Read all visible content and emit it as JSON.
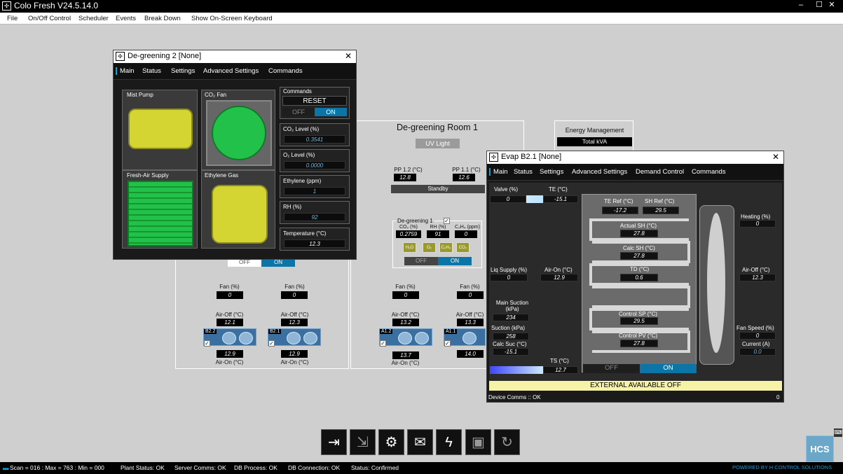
{
  "window": {
    "title": "Colo Fresh V24.5.14.0",
    "app_icon": "app-logo-icon"
  },
  "menu": [
    "File",
    "On/Off Control",
    "Scheduler",
    "Events",
    "Break Down",
    "Show On-Screen Keyboard"
  ],
  "room": {
    "title": "De-greening Room 1",
    "uv_light_label": "UV Light",
    "pp12_label": "PP 1.2 (°C)",
    "pp12_value": "12.8",
    "pp11_label": "PP 1.1 (°C)",
    "pp11_value": "12.6",
    "standby_label": "Standby",
    "deg1_label": "De-greening 1",
    "deg1_co2_label": "CO₂ (%)",
    "deg1_co2_value": "0.2759",
    "deg1_rh_label": "RH (%)",
    "deg1_rh_value": "91",
    "deg1_c2h4_label": "C₂H₄ (ppm)",
    "deg1_c2h4_value": "0",
    "deg1_icons": [
      "H₂O",
      "O₂",
      "C₂H₄",
      "CO₂"
    ],
    "off_label": "OFF",
    "on_label": "ON"
  },
  "energy": {
    "title": "Energy Management",
    "total_kva_label": "Total kVA"
  },
  "left_room": {
    "off_label": "OFF",
    "on_label": "ON",
    "units": [
      {
        "fan_label": "Fan (%)",
        "fan_value": "0",
        "airoff_label": "Air-Off (°C)",
        "airoff_value": "12.1",
        "tag": "B2.2",
        "airon_value": "12.9",
        "airon_label": "Air-On (°C)"
      },
      {
        "fan_label": "Fan (%)",
        "fan_value": "0",
        "airoff_label": "Air-Off (°C)",
        "airoff_value": "12.3",
        "tag": "B2.1",
        "airon_value": "12.9",
        "airon_label": "Air-On (°C)"
      }
    ]
  },
  "right_room": {
    "units": [
      {
        "fan_label": "Fan (%)",
        "fan_value": "0",
        "airoff_label": "Air-Off (°C)",
        "airoff_value": "13.2",
        "tag": "A1.2",
        "airon_value": "13.7",
        "airon_label": "Air-On (°C)"
      },
      {
        "fan_label": "Fan (%)",
        "fan_value": "0",
        "airoff_label": "Air-Off (°C)",
        "airoff_value": "13.3",
        "tag": "A1.1",
        "airon_value": "14.0",
        "airon_label": "Air-On (°C)"
      }
    ]
  },
  "dialog1": {
    "title": "De-greening 2 [None]",
    "tabs": [
      "Main",
      "Status",
      "Settings",
      "Advanced Settings",
      "Commands"
    ],
    "mist_pump": "Mist Pump",
    "co2_fan": "CO₂ Fan",
    "fresh_air": "Fresh-Air Supply",
    "ethylene_gas": "Ethylene Gas",
    "commands_label": "Commands",
    "reset_label": "RESET",
    "off_label": "OFF",
    "on_label": "ON",
    "co2_label": "CO₂ Level (%)",
    "co2_value": "0.3541",
    "o2_label": "O₂ Level (%)",
    "o2_value": "0.0000",
    "ethylene_label": "Ethylene (ppm)",
    "ethylene_value": "1",
    "rh_label": "RH (%)",
    "rh_value": "92",
    "temp_label": "Temperature (°C)",
    "temp_value": "12.3"
  },
  "dialog2": {
    "title": "Evap B2.1 [None]",
    "tabs": [
      "Main",
      "Status",
      "Settings",
      "Advanced Settings",
      "Demand Control",
      "Commands"
    ],
    "valve_label": "Valve (%)",
    "valve_value": "0",
    "te_label": "TE (°C)",
    "te_value": "-15.1",
    "te_ref_label": "TE Ref (°C)",
    "te_ref_value": "-17.2",
    "sh_ref_label": "SH Ref (°C)",
    "sh_ref_value": "29.5",
    "actual_sh_label": "Actual SH (°C)",
    "actual_sh_value": "27.8",
    "calc_sh_label": "Calc SH (°C)",
    "calc_sh_value": "27.8",
    "td_label": "TD (°C)",
    "td_value": "0.6",
    "control_sp_label": "Control SP (°C)",
    "control_sp_value": "29.5",
    "control_pv_label": "Control PV (°C)",
    "control_pv_value": "27.8",
    "liq_supply_label": "Liq Supply (%)",
    "liq_supply_value": "0",
    "air_on_label": "Air-On (°C)",
    "air_on_value": "12.9",
    "main_suction_label": "Main Suction (kPa)",
    "main_suction_value": "234",
    "suction_label": "Suction (kPa)",
    "suction_value": "258",
    "calc_suc_label": "Calc Suc (°C)",
    "calc_suc_value": "-15.1",
    "ts_label": "TS (°C)",
    "ts_value": "12.7",
    "heating_label": "Heating (%)",
    "heating_value": "0",
    "air_off_label": "Air-Off (°C)",
    "air_off_value": "12.3",
    "fan_speed_label": "Fan Speed (%)",
    "fan_speed_value": "0",
    "current_label": "Current (A)",
    "current_value": "0.0",
    "off_label": "OFF",
    "on_label": "ON",
    "external_label": "EXTERNAL AVAILABLE OFF",
    "comms_label": "Device Comms :: OK",
    "comms_count": "0"
  },
  "toolbar": [
    "login-icon",
    "logout-icon",
    "user-settings-icon",
    "mail-icon",
    "power-icon",
    "save-icon",
    "refresh-icon"
  ],
  "logo_text": "HCS",
  "status": {
    "scan": "Scan = 016 : Max = 763 : Min = 000",
    "plant": "Plant Status: OK",
    "server": "Server Comms: OK",
    "db_process": "DB Process:  OK",
    "db_connection": "DB Connection:  OK",
    "status": "Status:  Confirmed",
    "powered": "POWERED BY H CONTROL SOLUTIONS"
  },
  "colors": {
    "accent": "#0b75a8",
    "highlight_text": "#6fb7e3",
    "external_banner": "#f6f3a6",
    "equipment_green": "#22c24a",
    "equipment_yellow": "#d4d432"
  }
}
